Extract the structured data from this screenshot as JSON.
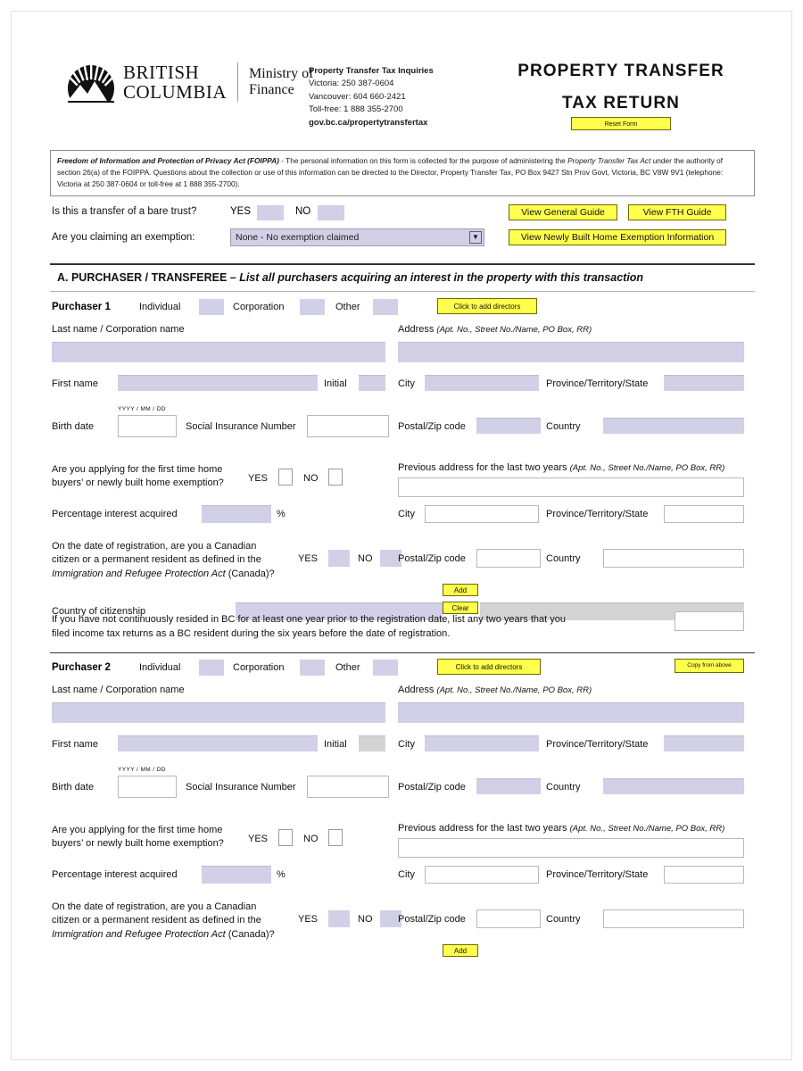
{
  "header": {
    "logo_line1": "BRITISH",
    "logo_line2": "COLUMBIA",
    "ministry_line1": "Ministry of",
    "ministry_line2": "Finance",
    "inquiries_title": "Property Transfer Tax Inquiries",
    "inquiries_victoria": "Victoria:  250 387-0604",
    "inquiries_vancouver": "Vancouver:  604 660-2421",
    "inquiries_tollfree": "Toll-free:  1 888 355-2700",
    "inquiries_web": "gov.bc.ca/propertytransfertax",
    "title_line1": "PROPERTY  TRANSFER",
    "title_line2": "TAX  RETURN",
    "reset_button": "Reset Form"
  },
  "foippa": {
    "act_name": "Freedom of Information and Protection of Privacy Act (FOIPPA)",
    "body_1": " - The personal information on this form is collected for the purpose of administering the ",
    "italic_1": "Property Transfer Tax Act",
    "body_2": " under the authority of section 26(a) of the FOIPPA.  Questions about the collection or use of this information can be directed to the Director, Property Transfer Tax, PO Box 9427 Stn Prov Govt, Victoria, BC  V8W 9V1 (telephone:  Victoria at 250 387-0604 or toll-free at 1 888 355-2700)."
  },
  "top_questions": {
    "bare_trust_label": "Is this a transfer of a bare trust?",
    "yes_label": "YES",
    "no_label": "NO",
    "exemption_label": "Are you claiming an exemption:",
    "exemption_value": "None - No exemption claimed",
    "dropdown_arrow": "▼",
    "btn_general_guide": "View General Guide",
    "btn_fth_guide": "View FTH Guide",
    "btn_newly_built": "View Newly Built Home Exemption Information"
  },
  "section_a": {
    "heading_bold": "A.  PURCHASER / TRANSFEREE – ",
    "heading_italic": "List all purchasers acquiring an interest in the property with this transaction"
  },
  "labels": {
    "individual": "Individual",
    "corporation": "Corporation",
    "other": "Other",
    "add_directors": "Click to add directors",
    "copy_from_above": "Copy from above",
    "last_name": "Last name / Corporation name",
    "address": "Address ",
    "address_italic": "(Apt. No., Street No./Name, PO Box, RR)",
    "first_name": "First name",
    "initial": "Initial",
    "city": "City",
    "province": "Province/Territory/State",
    "birth_date": "Birth date",
    "birth_hint": "YYYY / MM / DD",
    "sin": "Social Insurance Number",
    "postal": "Postal/Zip code",
    "country": "Country",
    "fth_question_l1": "Are you applying for the first time home",
    "fth_question_l2": "buyers’ or newly built home exemption?",
    "prev_address": "Previous address for the last two years ",
    "prev_address_italic": "(Apt. No., Street No./Name, PO Box, RR)",
    "percentage": "Percentage interest acquired",
    "percent_sign": "%",
    "citizen_l1": "On the date of registration, are you a Canadian",
    "citizen_l2": "citizen or a permanent resident as defined in the",
    "citizen_l3_italic": "Immigration and Refugee Protection Act",
    "citizen_l3_rest": " (Canada)?",
    "citizenship_country": "Country of citizenship",
    "btn_add": "Add",
    "btn_clear": "Clear",
    "residency_l1": "If you have not continuously resided in BC for at least one year prior to the registration date, list any two years that you",
    "residency_l2": "filed income tax returns as a BC resident during the six years before the date of registration."
  },
  "purchasers": [
    {
      "title": "Purchaser 1"
    },
    {
      "title": "Purchaser 2"
    }
  ],
  "colors": {
    "field_fill": "#d2d0e6",
    "button_yellow": "#ffff4d",
    "button_border": "#6b6b00"
  }
}
